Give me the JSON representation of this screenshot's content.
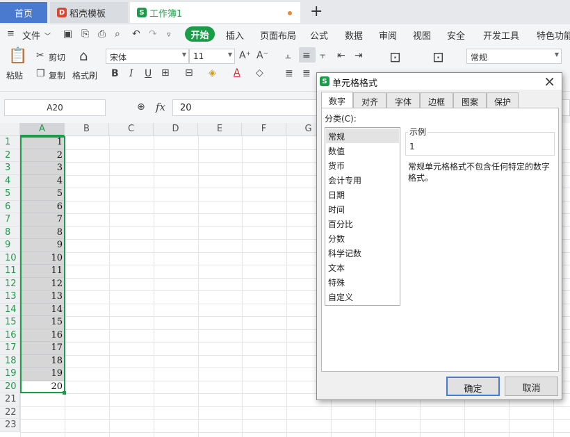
{
  "tabs": {
    "home": "首页",
    "daoke": "稻壳模板",
    "book": "工作簿1",
    "new_tab": "+"
  },
  "menu": {
    "file": "文件",
    "items": [
      "开始",
      "插入",
      "页面布局",
      "公式",
      "数据",
      "审阅",
      "视图",
      "安全",
      "开发工具",
      "特色功能"
    ]
  },
  "ribbon": {
    "paste": "粘贴",
    "cut": "剪切",
    "copy": "复制",
    "format_painter": "格式刷",
    "font_name": "宋体",
    "font_size": "11",
    "bold": "B",
    "italic": "I",
    "underline": "U",
    "number_format": "常规"
  },
  "formula_bar": {
    "name_box": "A20",
    "fx": "fx",
    "value": "20"
  },
  "sheet": {
    "columns": [
      "A",
      "B",
      "C",
      "D",
      "E",
      "F",
      "G"
    ],
    "rows": [
      "1",
      "2",
      "3",
      "4",
      "5",
      "6",
      "7",
      "8",
      "9",
      "10",
      "11",
      "12",
      "13",
      "14",
      "15",
      "16",
      "17",
      "18",
      "19",
      "20",
      "21",
      "22",
      "23"
    ],
    "col_a_values": [
      "1",
      "2",
      "3",
      "4",
      "5",
      "6",
      "7",
      "8",
      "9",
      "10",
      "11",
      "12",
      "13",
      "14",
      "15",
      "16",
      "17",
      "18",
      "19",
      "20"
    ]
  },
  "dialog": {
    "title": "单元格格式",
    "tabs": [
      "数字",
      "对齐",
      "字体",
      "边框",
      "图案",
      "保护"
    ],
    "category_label": "分类(C):",
    "categories": [
      "常规",
      "数值",
      "货币",
      "会计专用",
      "日期",
      "时间",
      "百分比",
      "分数",
      "科学记数",
      "文本",
      "特殊",
      "自定义"
    ],
    "sample_label": "示例",
    "sample_value": "1",
    "description": "常规单元格格式不包含任何特定的数字格式。",
    "ok": "确定",
    "cancel": "取消",
    "close": "×"
  },
  "colors": {
    "accent_green": "#1b9c4a",
    "home_tab_blue": "#4a79d0",
    "daoke_red": "#e0452f"
  }
}
